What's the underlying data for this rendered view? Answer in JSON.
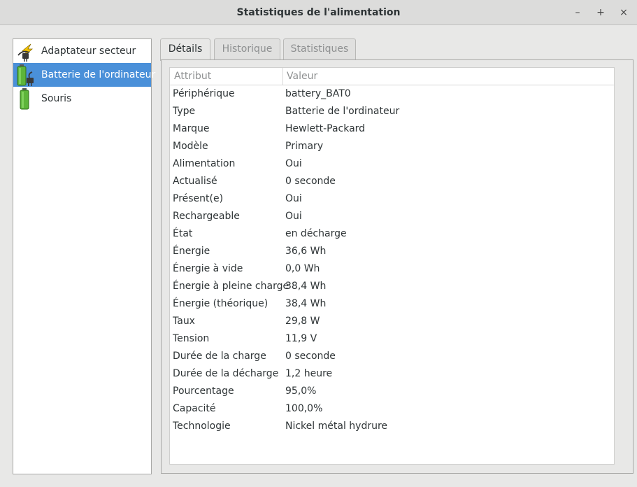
{
  "window": {
    "title": "Statistiques de l'alimentation",
    "buttons": {
      "minimize": "–",
      "maximize": "+",
      "close": "×"
    }
  },
  "devices": [
    {
      "label": "Adaptateur secteur",
      "icon": "ac-adapter-icon",
      "selected": false
    },
    {
      "label": "Batterie de l'ordinateur",
      "icon": "battery-icon",
      "selected": true
    },
    {
      "label": "Souris",
      "icon": "mouse-battery-icon",
      "selected": false
    }
  ],
  "tabs": [
    {
      "label": "Détails",
      "active": true
    },
    {
      "label": "Historique",
      "active": false
    },
    {
      "label": "Statistiques",
      "active": false
    }
  ],
  "table": {
    "headers": {
      "attribute": "Attribut",
      "value": "Valeur"
    },
    "rows": [
      {
        "k": "Périphérique",
        "v": "battery_BAT0"
      },
      {
        "k": "Type",
        "v": "Batterie de l'ordinateur"
      },
      {
        "k": "Marque",
        "v": "Hewlett-Packard"
      },
      {
        "k": "Modèle",
        "v": "Primary"
      },
      {
        "k": "Alimentation",
        "v": "Oui"
      },
      {
        "k": "Actualisé",
        "v": "0 seconde"
      },
      {
        "k": "Présent(e)",
        "v": "Oui"
      },
      {
        "k": "Rechargeable",
        "v": "Oui"
      },
      {
        "k": "État",
        "v": "en décharge"
      },
      {
        "k": "Énergie",
        "v": "36,6 Wh"
      },
      {
        "k": "Énergie à vide",
        "v": "0,0 Wh"
      },
      {
        "k": "Énergie à pleine charge",
        "v": "38,4 Wh"
      },
      {
        "k": "Énergie (théorique)",
        "v": "38,4 Wh"
      },
      {
        "k": "Taux",
        "v": "29,8 W"
      },
      {
        "k": "Tension",
        "v": "11,9 V"
      },
      {
        "k": "Durée de la charge",
        "v": "0 seconde"
      },
      {
        "k": "Durée de la décharge",
        "v": "1,2 heure"
      },
      {
        "k": "Pourcentage",
        "v": "95,0%"
      },
      {
        "k": "Capacité",
        "v": "100,0%"
      },
      {
        "k": "Technologie",
        "v": "Nickel métal hydrure"
      }
    ]
  },
  "colors": {
    "selection": "#4a90d9",
    "battery_green": "#5db53a"
  }
}
